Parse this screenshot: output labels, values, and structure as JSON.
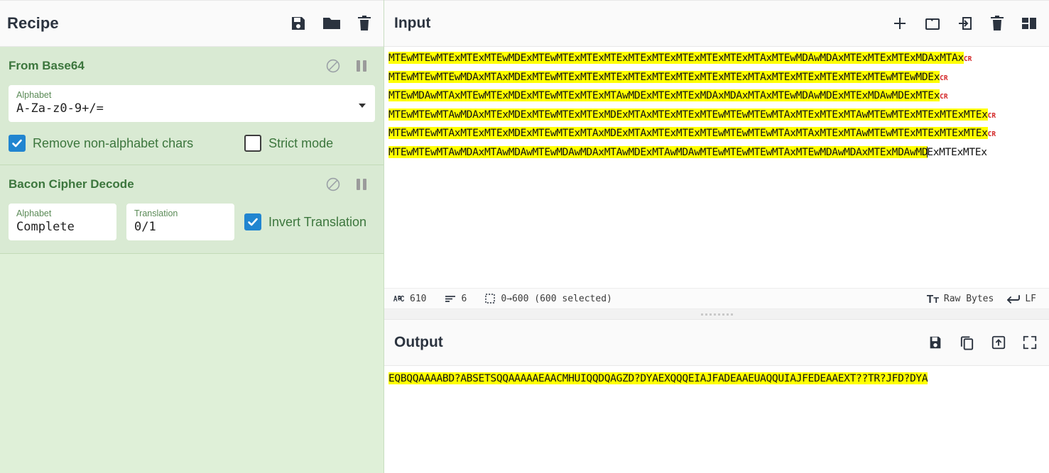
{
  "recipe": {
    "title": "Recipe",
    "icons": [
      {
        "name": "save-recipe-icon",
        "glyph": "save"
      },
      {
        "name": "load-recipe-icon",
        "glyph": "folder"
      },
      {
        "name": "clear-recipe-icon",
        "glyph": "trash"
      }
    ],
    "operations": [
      {
        "title": "From Base64",
        "disable_icon": "disable-icon",
        "pause_icon": "breakpoint-icon",
        "args": [
          {
            "label": "Alphabet",
            "value": "A-Za-z0-9+/=",
            "type": "select"
          }
        ],
        "checkboxes": [
          {
            "label": "Remove non-alphabet chars",
            "checked": true
          },
          {
            "label": "Strict mode",
            "checked": false
          }
        ]
      },
      {
        "title": "Bacon Cipher Decode",
        "disable_icon": "disable-icon",
        "pause_icon": "breakpoint-icon",
        "args": [
          {
            "label": "Alphabet",
            "value": "Complete",
            "type": "select"
          },
          {
            "label": "Translation",
            "value": "0/1",
            "type": "select"
          }
        ],
        "checkboxes": [
          {
            "label": "Invert Translation",
            "checked": true
          }
        ]
      }
    ]
  },
  "input": {
    "title": "Input",
    "icons": [
      {
        "name": "add-input-tab-icon",
        "glyph": "plus"
      },
      {
        "name": "open-folder-as-input-icon",
        "glyph": "folder-open"
      },
      {
        "name": "open-file-as-input-icon",
        "glyph": "file-import"
      },
      {
        "name": "clear-input-icon",
        "glyph": "trash"
      },
      {
        "name": "reset-pane-layout-icon",
        "glyph": "layout"
      }
    ],
    "lines": [
      {
        "selected": "MTEwMTEwMTExMTExMTEwMDExMTEwMTExMTExMTExMTExMTExMTExMTExMTExMTAxMTEwMDAwMDAxMTExMTExMTExMDAxMTAx",
        "unselected": ""
      },
      {
        "selected": "MTEwMTEwMTEwMDAxMTAxMDExMTEwMTExMTExMTExMTExMTExMTExMTExMTExMTAxMTExMTExMTExMTExMTEwMTEwMDEx",
        "unselected": ""
      },
      {
        "selected": "MTEwMDAwMTAxMTEwMTExMDExMTEwMTExMTExMTAwMDExMTExMTExMDAxMDAxMTAxMTEwMDAwMDExMTExMDAwMDExMTEx",
        "unselected": ""
      },
      {
        "selected": "MTEwMTEwMTAwMDAxMTExMDExMTEwMTExMTExMDExMTAxMTExMTExMTEwMTEwMTEwMTAxMTExMTExMTAwMTEwMTExMTExMTExMTEx",
        "unselected": ""
      },
      {
        "selected": "MTEwMTEwMTAxMTExMTExMDExMTEwMTExMTAxMDExMTAxMTExMTExMTEwMTEwMTEwMTAxMTAxMTExMTAwMTEwMTExMTExMTExMTEx",
        "unselected": ""
      },
      {
        "selected": "MTEwMTEwMTAwMDAxMTAwMDAwMTEwMDAwMDAxMTAwMDExMTAwMDAwMTEwMTEwMTEwMTAxMTEwMDAwMDAxMTExMDAwMD",
        "unselected": "ExMTExMTEx"
      }
    ],
    "crlf_marker": "CR",
    "status": {
      "length_icon": "abc-icon",
      "length": "610",
      "lines_icon": "lines-icon",
      "lines": "6",
      "selection_icon": "selection-icon",
      "selection": "0→600 (600 selected)",
      "encoding_icon": "font-icon",
      "encoding": "Raw Bytes",
      "line_ending_icon": "return-icon",
      "line_ending": "LF"
    }
  },
  "output": {
    "title": "Output",
    "icons": [
      {
        "name": "save-output-icon",
        "glyph": "save"
      },
      {
        "name": "copy-output-icon",
        "glyph": "copy"
      },
      {
        "name": "replace-input-with-output-icon",
        "glyph": "upload"
      },
      {
        "name": "maximise-output-icon",
        "glyph": "expand"
      }
    ],
    "text": "EQBQQAAAABD?ABSETSQQAAAAAEAACMHUIQQDQAGZD?DYAEXQQQEIAJFADEAAEUAQQUIAJFEDEAAEXT??TR?JFD?DYA"
  },
  "colors": {
    "recipe_bg": "#dff0d8",
    "op_bg": "#d9ead3",
    "op_title": "#3c763d",
    "highlight": "#ffff00",
    "checkbox_on": "#2185d0",
    "cr_marker": "#d42a2a"
  }
}
